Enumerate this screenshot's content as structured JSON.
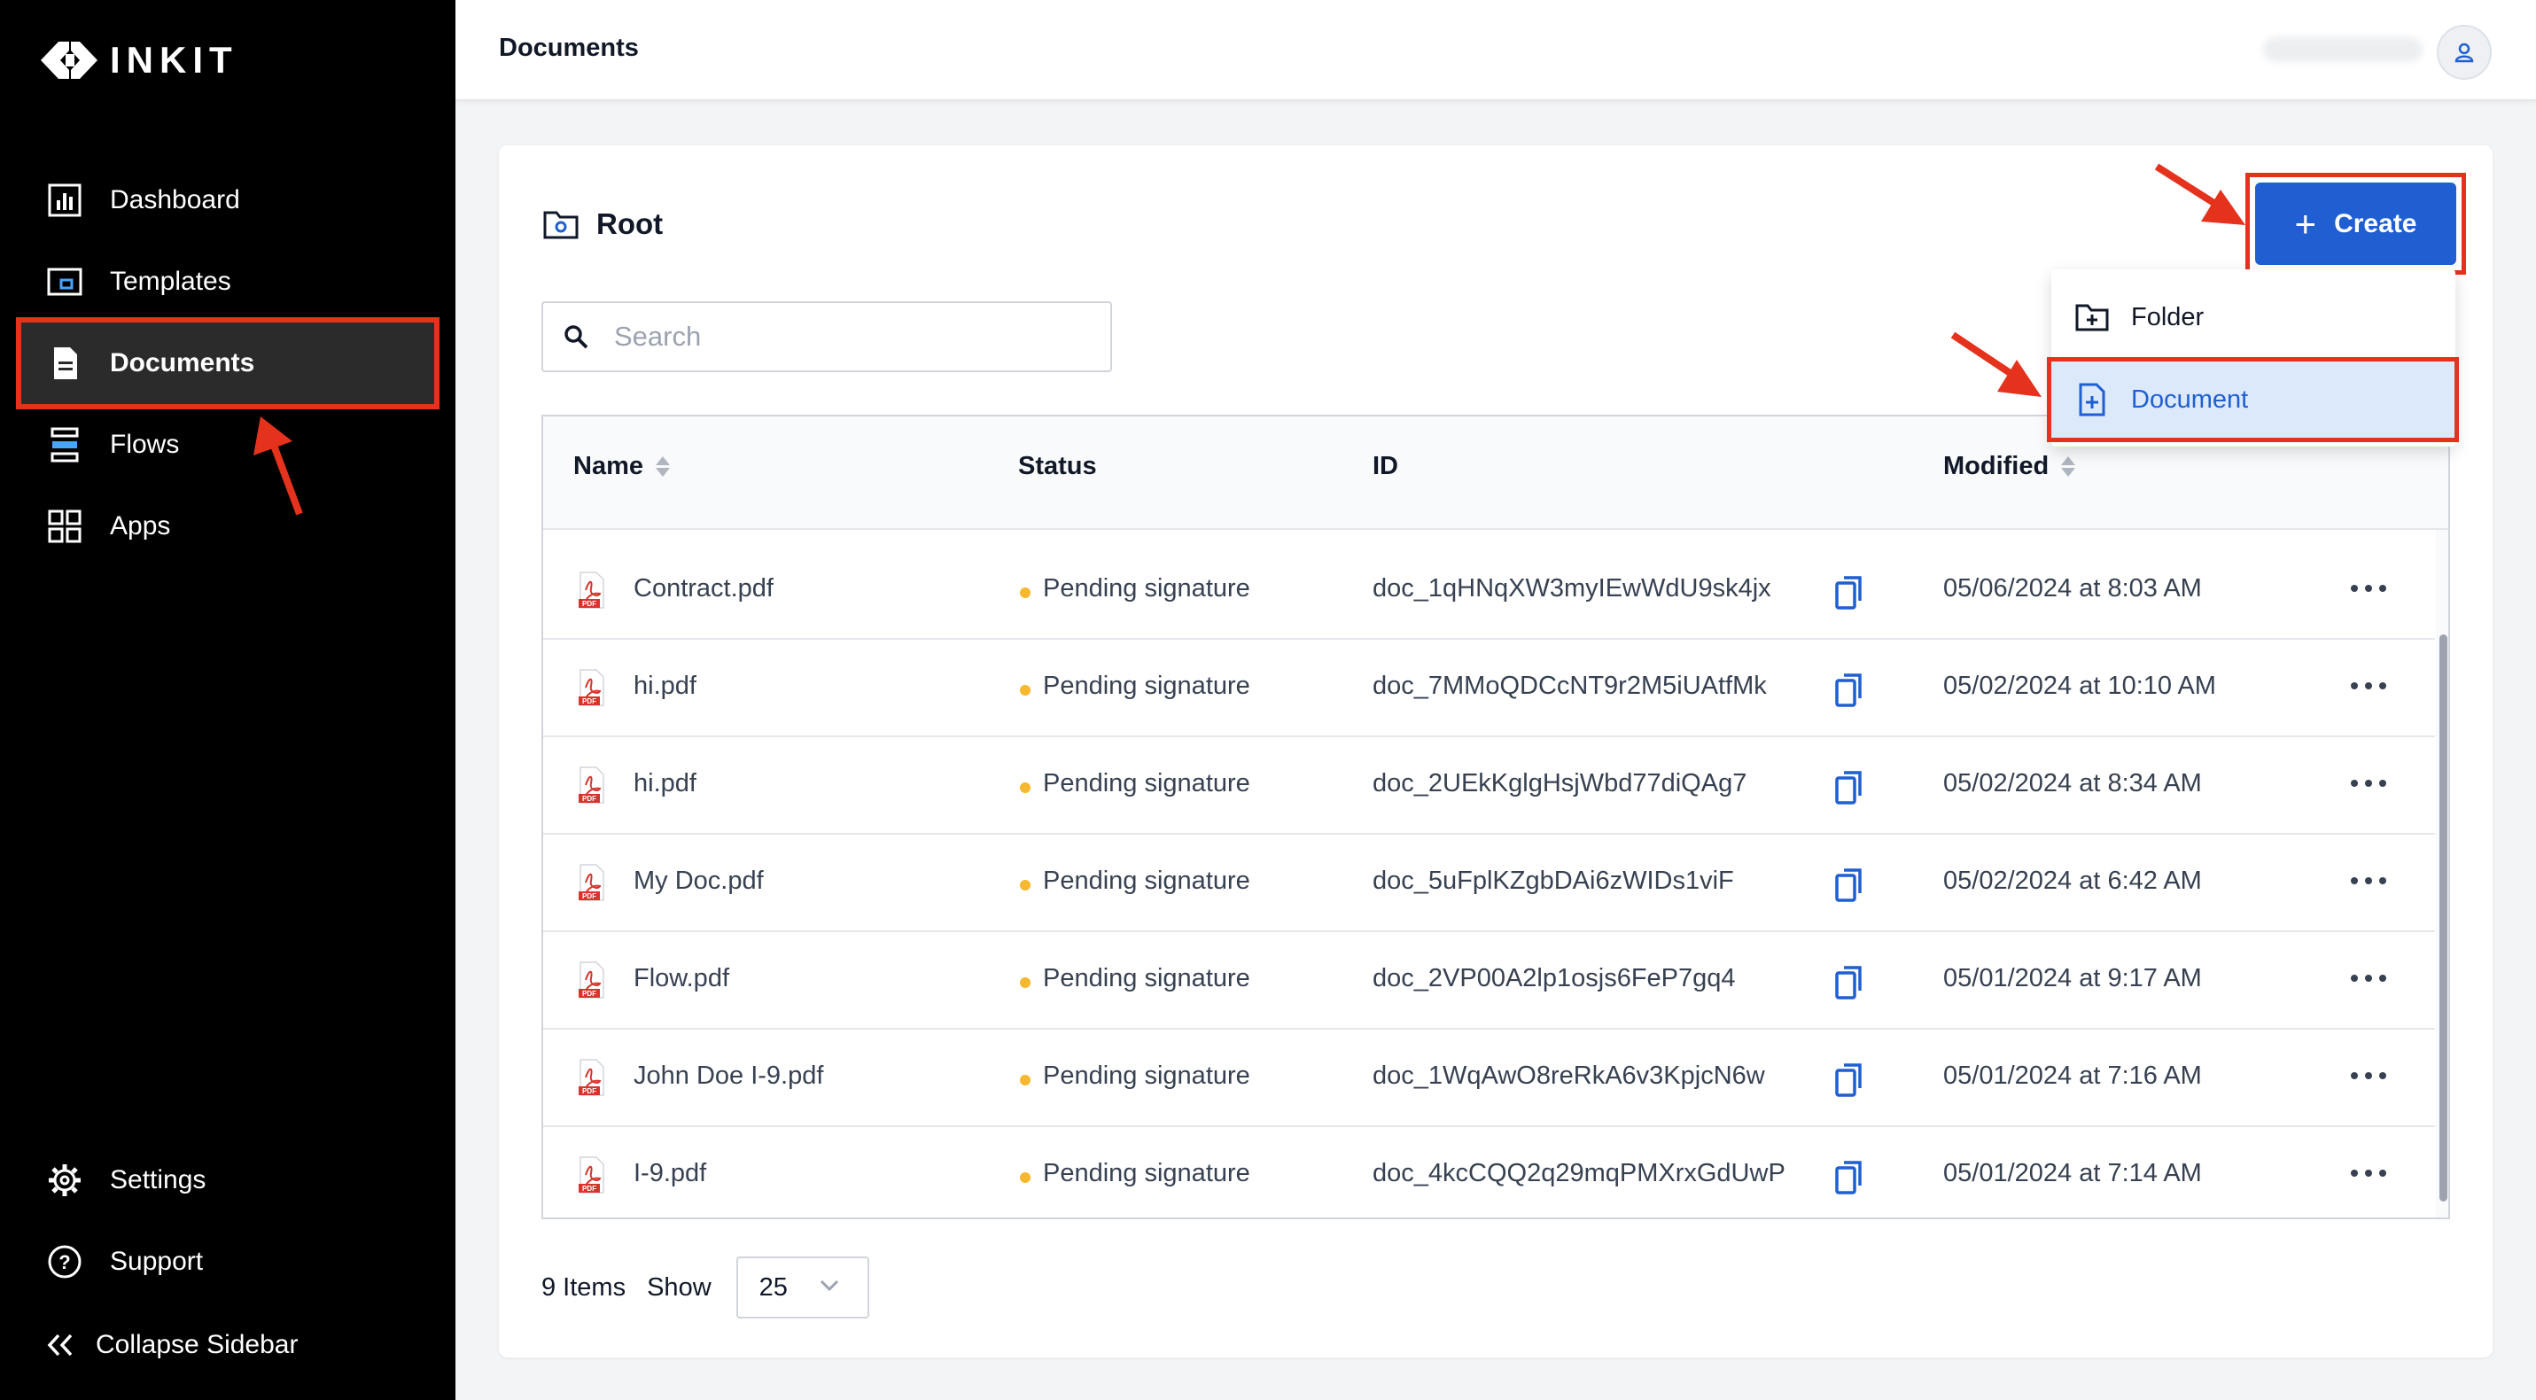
{
  "app": {
    "brand": "INKIT"
  },
  "sidebar": {
    "items": [
      {
        "label": "Dashboard",
        "icon": "dashboard-icon"
      },
      {
        "label": "Templates",
        "icon": "templates-icon"
      },
      {
        "label": "Documents",
        "icon": "document-icon",
        "active": true
      },
      {
        "label": "Flows",
        "icon": "flows-icon"
      },
      {
        "label": "Apps",
        "icon": "apps-icon"
      }
    ],
    "bottom": [
      {
        "label": "Settings",
        "icon": "gear-icon"
      },
      {
        "label": "Support",
        "icon": "help-icon"
      },
      {
        "label": "Collapse Sidebar",
        "icon": "double-chevron-left-icon"
      }
    ]
  },
  "header": {
    "title": "Documents"
  },
  "main": {
    "folder_title": "Root",
    "create_label": "Create",
    "search_placeholder": "Search",
    "create_menu": [
      {
        "label": "Folder",
        "icon": "folder-plus-icon"
      },
      {
        "label": "Document",
        "icon": "file-plus-icon",
        "highlighted": true
      }
    ],
    "table": {
      "columns": [
        "Name",
        "Status",
        "ID",
        "Modified"
      ],
      "rows": [
        {
          "name": "Contract.pdf",
          "status": "Pending signature",
          "id": "doc_1qHNqXW3myIEwWdU9sk4jx",
          "modified": "05/06/2024 at 8:03 AM"
        },
        {
          "name": "hi.pdf",
          "status": "Pending signature",
          "id": "doc_7MMoQDCcNT9r2M5iUAtfMk",
          "modified": "05/02/2024 at 10:10 AM"
        },
        {
          "name": "hi.pdf",
          "status": "Pending signature",
          "id": "doc_2UEkKglgHsjWbd77diQAg7",
          "modified": "05/02/2024 at 8:34 AM"
        },
        {
          "name": "My Doc.pdf",
          "status": "Pending signature",
          "id": "doc_5uFplKZgbDAi6zWIDs1viF",
          "modified": "05/02/2024 at 6:42 AM"
        },
        {
          "name": "Flow.pdf",
          "status": "Pending signature",
          "id": "doc_2VP00A2lp1osjs6FeP7gq4",
          "modified": "05/01/2024 at 9:17 AM"
        },
        {
          "name": "John Doe I-9.pdf",
          "status": "Pending signature",
          "id": "doc_1WqAwO8reRkA6v3KpjcN6w",
          "modified": "05/01/2024 at 7:16 AM"
        },
        {
          "name": "I-9.pdf",
          "status": "Pending signature",
          "id": "doc_4kcCQQ2q29mqPMXrxGdUwP",
          "modified": "05/01/2024 at 7:14 AM"
        }
      ]
    },
    "footer": {
      "items_count": "9 Items",
      "show_label": "Show",
      "page_size": "25"
    }
  },
  "colors": {
    "sidebar_bg": "#000000",
    "accent_blue": "#1f5fd1",
    "annotation_red": "#e5321d",
    "status_pending": "#f5b82e"
  }
}
